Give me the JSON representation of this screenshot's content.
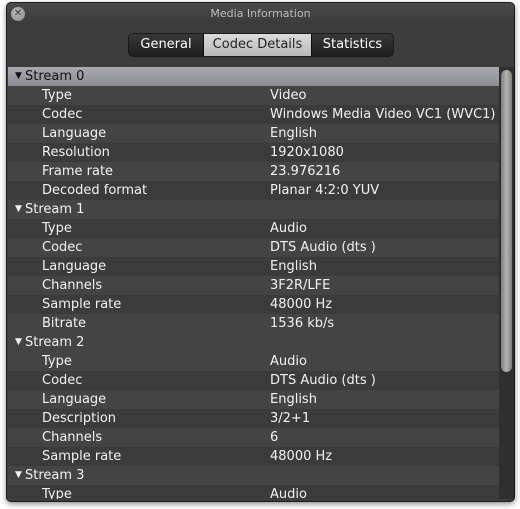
{
  "window": {
    "title": "Media Information",
    "close_glyph": "✕"
  },
  "tabs": [
    {
      "label": "General",
      "active": false
    },
    {
      "label": "Codec Details",
      "active": true
    },
    {
      "label": "Statistics",
      "active": false
    }
  ],
  "streams": [
    {
      "label": "Stream 0",
      "expanded": true,
      "properties": [
        {
          "key": "Type",
          "value": "Video"
        },
        {
          "key": "Codec",
          "value": "Windows Media Video VC1 (WVC1)"
        },
        {
          "key": "Language",
          "value": "English"
        },
        {
          "key": "Resolution",
          "value": "1920x1080"
        },
        {
          "key": "Frame rate",
          "value": "23.976216"
        },
        {
          "key": "Decoded format",
          "value": "Planar 4:2:0 YUV"
        }
      ]
    },
    {
      "label": "Stream 1",
      "expanded": true,
      "properties": [
        {
          "key": "Type",
          "value": "Audio"
        },
        {
          "key": "Codec",
          "value": "DTS Audio (dts )"
        },
        {
          "key": "Language",
          "value": "English"
        },
        {
          "key": "Channels",
          "value": "3F2R/LFE"
        },
        {
          "key": "Sample rate",
          "value": "48000 Hz"
        },
        {
          "key": "Bitrate",
          "value": "1536 kb/s"
        }
      ]
    },
    {
      "label": "Stream 2",
      "expanded": true,
      "properties": [
        {
          "key": "Type",
          "value": "Audio"
        },
        {
          "key": "Codec",
          "value": "DTS Audio (dts )"
        },
        {
          "key": "Language",
          "value": "English"
        },
        {
          "key": "Description",
          "value": "3/2+1"
        },
        {
          "key": "Channels",
          "value": "6"
        },
        {
          "key": "Sample rate",
          "value": "48000 Hz"
        }
      ]
    },
    {
      "label": "Stream 3",
      "expanded": true,
      "properties": [
        {
          "key": "Type",
          "value": "Audio"
        }
      ]
    }
  ],
  "icons": {
    "close": "close-icon",
    "disclosure": "disclosure-triangle-icon"
  },
  "colors": {
    "selected_header": "#9a9ba1",
    "window_bg": "#3d3d3d",
    "row_alt": "#444444"
  }
}
